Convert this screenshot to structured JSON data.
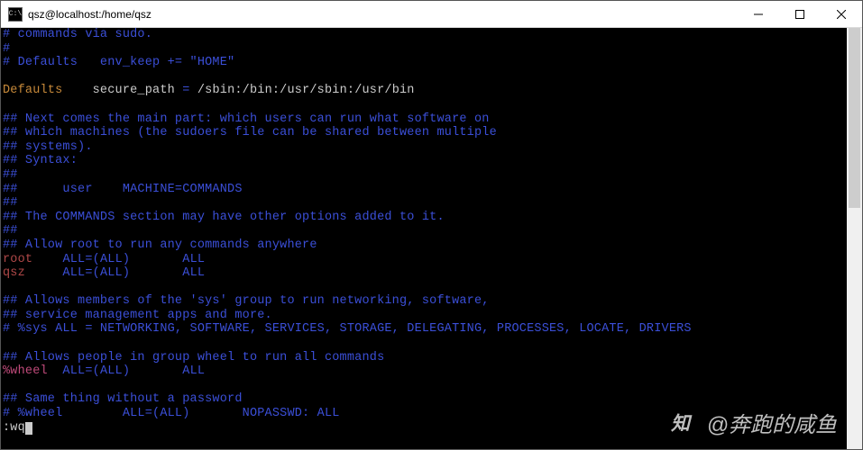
{
  "window": {
    "title": "qsz@localhost:/home/qsz",
    "buttons": {
      "min": "—",
      "max": "☐",
      "close": "✕"
    }
  },
  "terminal": {
    "lines": [
      {
        "t": "comment",
        "text": "# commands via sudo."
      },
      {
        "t": "comment",
        "text": "#"
      },
      {
        "t": "comment",
        "text": "# Defaults   env_keep += \"HOME\""
      },
      {
        "t": "blank",
        "text": ""
      },
      {
        "t": "defaults",
        "kw": "Defaults",
        "mid": "    secure_path ",
        "eq": "=",
        "val": " /sbin:/bin:/usr/sbin:/usr/bin"
      },
      {
        "t": "blank",
        "text": ""
      },
      {
        "t": "comment",
        "text": "## Next comes the main part: which users can run what software on"
      },
      {
        "t": "comment",
        "text": "## which machines (the sudoers file can be shared between multiple"
      },
      {
        "t": "comment",
        "text": "## systems)."
      },
      {
        "t": "comment",
        "text": "## Syntax:"
      },
      {
        "t": "comment",
        "text": "##"
      },
      {
        "t": "comment",
        "text": "##      user    MACHINE=COMMANDS"
      },
      {
        "t": "comment",
        "text": "##"
      },
      {
        "t": "comment",
        "text": "## The COMMANDS section may have other options added to it."
      },
      {
        "t": "comment",
        "text": "##"
      },
      {
        "t": "comment",
        "text": "## Allow root to run any commands anywhere"
      },
      {
        "t": "rule",
        "user": "root",
        "pad": "    ",
        "all1": "ALL",
        "eq": "=",
        "lp": "(",
        "allin": "ALL",
        "rp": ")",
        "pad2": "       ",
        "all2": "ALL"
      },
      {
        "t": "rule",
        "user": "qsz",
        "pad": "     ",
        "all1": "ALL",
        "eq": "=",
        "lp": "(",
        "allin": "ALL",
        "rp": ")",
        "pad2": "       ",
        "all2": "ALL"
      },
      {
        "t": "blank",
        "text": ""
      },
      {
        "t": "comment",
        "text": "## Allows members of the 'sys' group to run networking, software,"
      },
      {
        "t": "comment",
        "text": "## service management apps and more."
      },
      {
        "t": "comment",
        "text": "# %sys ALL = NETWORKING, SOFTWARE, SERVICES, STORAGE, DELEGATING, PROCESSES, LOCATE, DRIVERS"
      },
      {
        "t": "blank",
        "text": ""
      },
      {
        "t": "comment",
        "text": "## Allows people in group wheel to run all commands"
      },
      {
        "t": "grprule",
        "grp": "%wheel",
        "pad": "  ",
        "all1": "ALL",
        "eq": "=",
        "lp": "(",
        "allin": "ALL",
        "rp": ")",
        "pad2": "       ",
        "all2": "ALL"
      },
      {
        "t": "blank",
        "text": ""
      },
      {
        "t": "comment",
        "text": "## Same thing without a password"
      },
      {
        "t": "comment",
        "text": "# %wheel        ALL=(ALL)       NOPASSWD: ALL"
      },
      {
        "t": "cmdline",
        "text": ":wq"
      }
    ]
  },
  "watermark": {
    "text": "@奔跑的咸鱼"
  },
  "colors": {
    "comment": "#3b4fd8",
    "keyword": "#c88a3a",
    "string": "#cccccc",
    "user": "#b04848",
    "group": "#c04a7a",
    "bg": "#000000"
  }
}
